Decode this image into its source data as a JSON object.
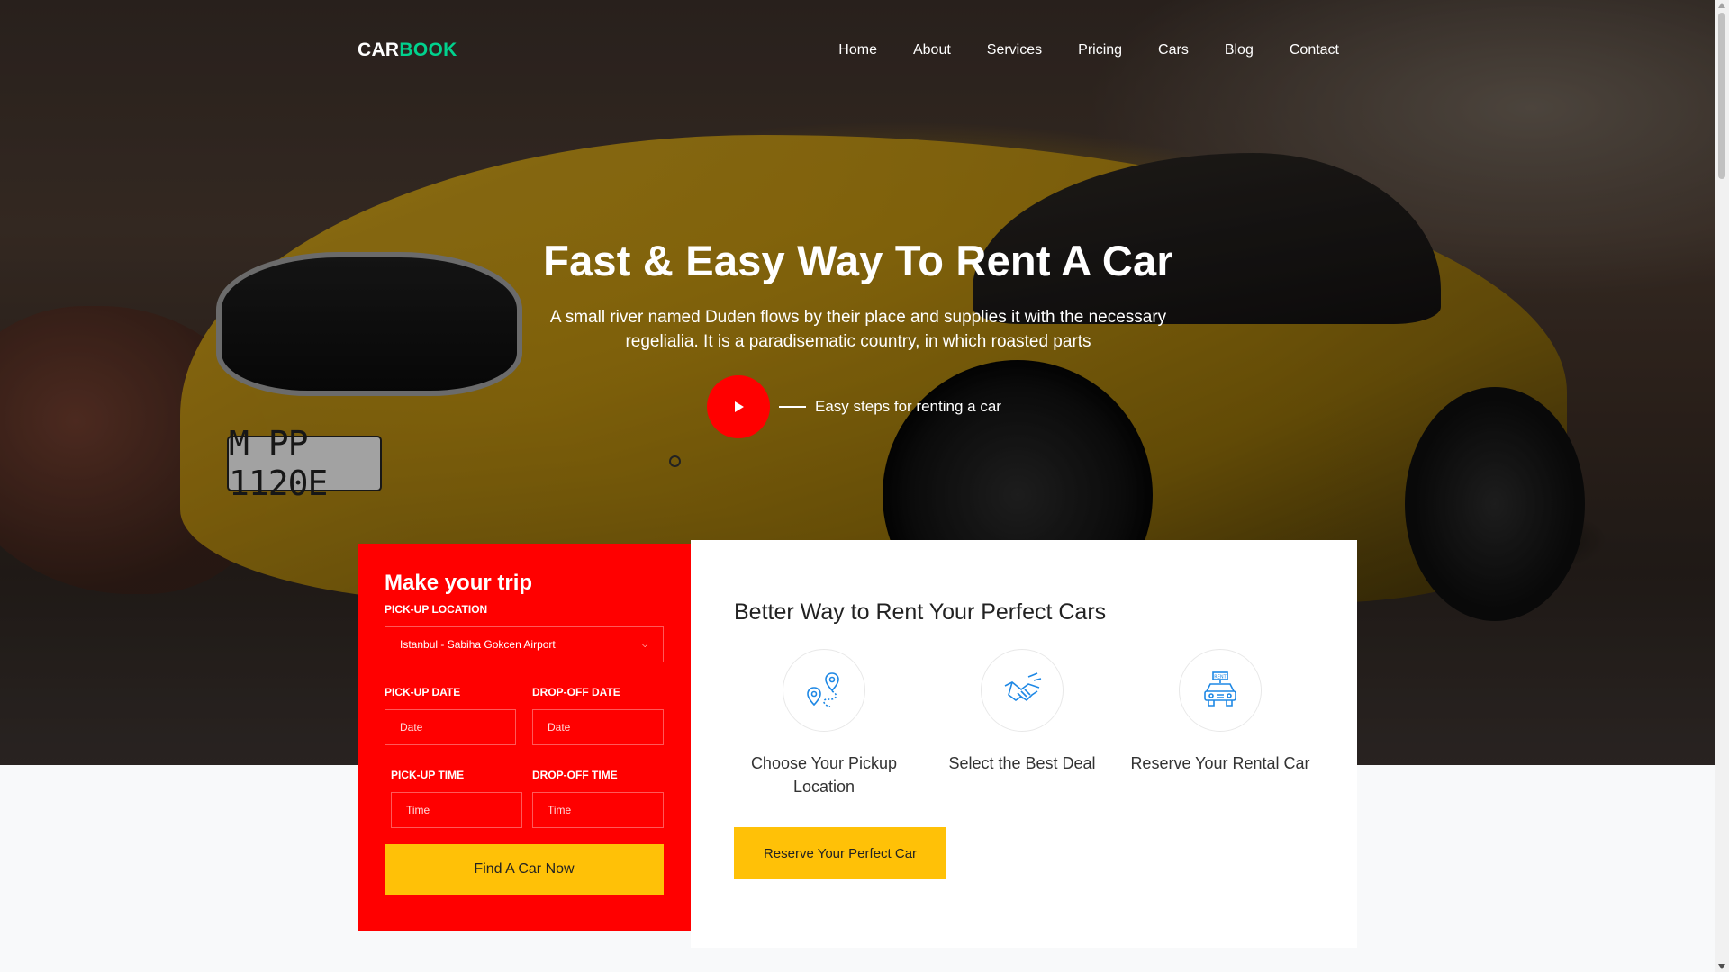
{
  "brand": {
    "part1": "CAR",
    "part2": "BOOK",
    "accent_color": "#01d28e"
  },
  "nav": {
    "items": [
      "Home",
      "About",
      "Services",
      "Pricing",
      "Cars",
      "Blog",
      "Contact"
    ]
  },
  "hero": {
    "title": "Fast & Easy Way To Rent A Car",
    "subtitle_line1": "A small river named Duden flows by their place and supplies it with the necessary",
    "subtitle_line2": "regelialia. It is a paradisematic country, in which roasted parts",
    "video_label": "Easy steps for renting a car",
    "plate_text": "M PP 1120E"
  },
  "trip_form": {
    "title": "Make your trip",
    "pickup_location_label": "PICK-UP LOCATION",
    "pickup_location_value": "Istanbul - Sabiha Gokcen Airport",
    "pickup_date_label": "PICK-UP DATE",
    "dropoff_date_label": "DROP-OFF DATE",
    "date_placeholder": "Date",
    "pickup_time_label": "PICK-UP TIME",
    "dropoff_time_label": "DROP-OFF TIME",
    "time_placeholder": "Time",
    "submit_label": "Find A Car Now",
    "bg_color": "#ff0000"
  },
  "info": {
    "title": "Better Way to Rent Your Perfect Cars",
    "features": [
      {
        "icon": "location-route-icon",
        "label": "Choose Your Pickup Location"
      },
      {
        "icon": "handshake-icon",
        "label": "Select the Best Deal"
      },
      {
        "icon": "rent-car-icon",
        "label": "Reserve Your Rental Car"
      }
    ],
    "cta_label": "Reserve Your Perfect Car",
    "cta_color": "#ffc107"
  }
}
